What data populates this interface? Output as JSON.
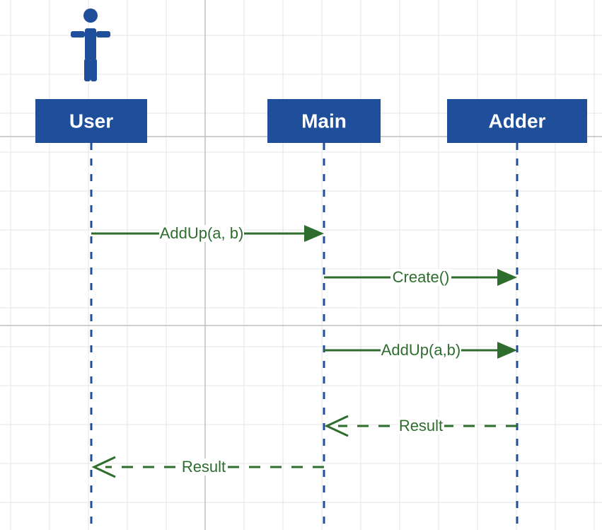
{
  "participants": {
    "user": {
      "label": "User"
    },
    "main": {
      "label": "Main"
    },
    "adder": {
      "label": "Adder"
    }
  },
  "messages": {
    "m1": {
      "label": "AddUp(a, b)"
    },
    "m2": {
      "label": "Create()"
    },
    "m3": {
      "label": "AddUp(a,b)"
    },
    "m4": {
      "label": "Result"
    },
    "m5": {
      "label": "Result"
    }
  },
  "colors": {
    "participant": "#1f4e9b",
    "message": "#2e6d2e"
  },
  "chart_data": {
    "type": "sequence-diagram",
    "participants": [
      "User",
      "Main",
      "Adder"
    ],
    "actor": "User",
    "messages": [
      {
        "from": "User",
        "to": "Main",
        "label": "AddUp(a, b)",
        "kind": "call",
        "style": "solid"
      },
      {
        "from": "Main",
        "to": "Adder",
        "label": "Create()",
        "kind": "call",
        "style": "solid"
      },
      {
        "from": "Main",
        "to": "Adder",
        "label": "AddUp(a,b)",
        "kind": "call",
        "style": "solid"
      },
      {
        "from": "Adder",
        "to": "Main",
        "label": "Result",
        "kind": "return",
        "style": "dashed"
      },
      {
        "from": "Main",
        "to": "User",
        "label": "Result",
        "kind": "return",
        "style": "dashed"
      }
    ]
  }
}
